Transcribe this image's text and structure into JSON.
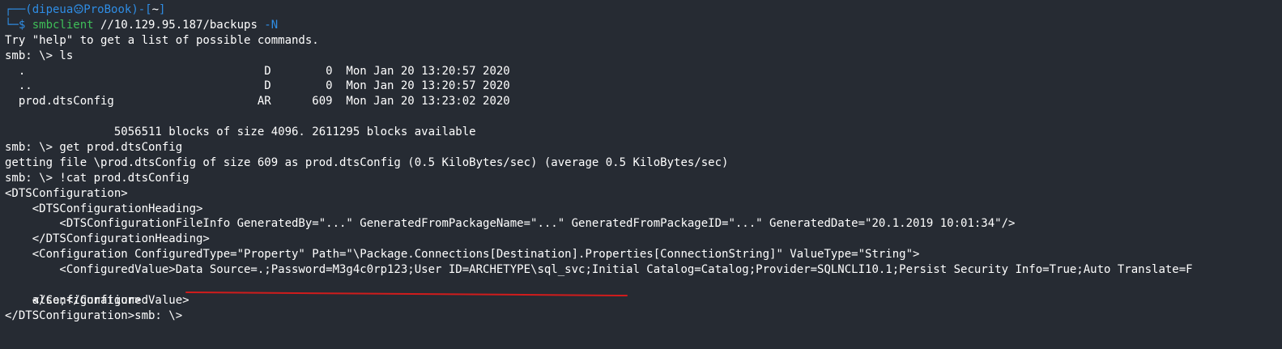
{
  "prompt": {
    "box_open": "┌──(",
    "user": "dipeua",
    "skull_icon": "skull-icon",
    "host": "ProBook",
    "box_mid": ")-[",
    "cwd": "~",
    "box_close": "]",
    "box_bottom": "└─",
    "dollar": "$ "
  },
  "command": {
    "name": "smbclient",
    "target": " //10.129.95.187/backups ",
    "flag": "-N"
  },
  "output": [
    "Try \"help\" to get a list of possible commands.",
    "smb: \\> ls",
    "  .                                   D        0  Mon Jan 20 13:20:57 2020",
    "  ..                                  D        0  Mon Jan 20 13:20:57 2020",
    "  prod.dtsConfig                     AR      609  Mon Jan 20 13:23:02 2020",
    "",
    "                5056511 blocks of size 4096. 2611295 blocks available",
    "smb: \\> get prod.dtsConfig",
    "getting file \\prod.dtsConfig of size 609 as prod.dtsConfig (0.5 KiloBytes/sec) (average 0.5 KiloBytes/sec)",
    "smb: \\> !cat prod.dtsConfig",
    "<DTSConfiguration>",
    "    <DTSConfigurationHeading>",
    "        <DTSConfigurationFileInfo GeneratedBy=\"...\" GeneratedFromPackageName=\"...\" GeneratedFromPackageID=\"...\" GeneratedDate=\"20.1.2019 10:01:34\"/>",
    "    </DTSConfigurationHeading>",
    "    <Configuration ConfiguredType=\"Property\" Path=\"\\Package.Connections[Destination].Properties[ConnectionString]\" ValueType=\"String\">",
    "        <ConfiguredValue>Data Source=.;Password=M3g4c0rp123;User ID=ARCHETYPE\\sql_svc;Initial Catalog=Catalog;Provider=SQLNCLI10.1;Persist Security Info=True;Auto Translate=F",
    "alse;</ConfiguredValue>",
    "    </Configuration>",
    "</DTSConfiguration>smb: \\>"
  ],
  "colors": {
    "background": "#262b33",
    "prompt_blue": "#2f8de4",
    "command_green": "#3fbf58",
    "text": "#ffffff",
    "annotation_red": "#d01c1c"
  }
}
